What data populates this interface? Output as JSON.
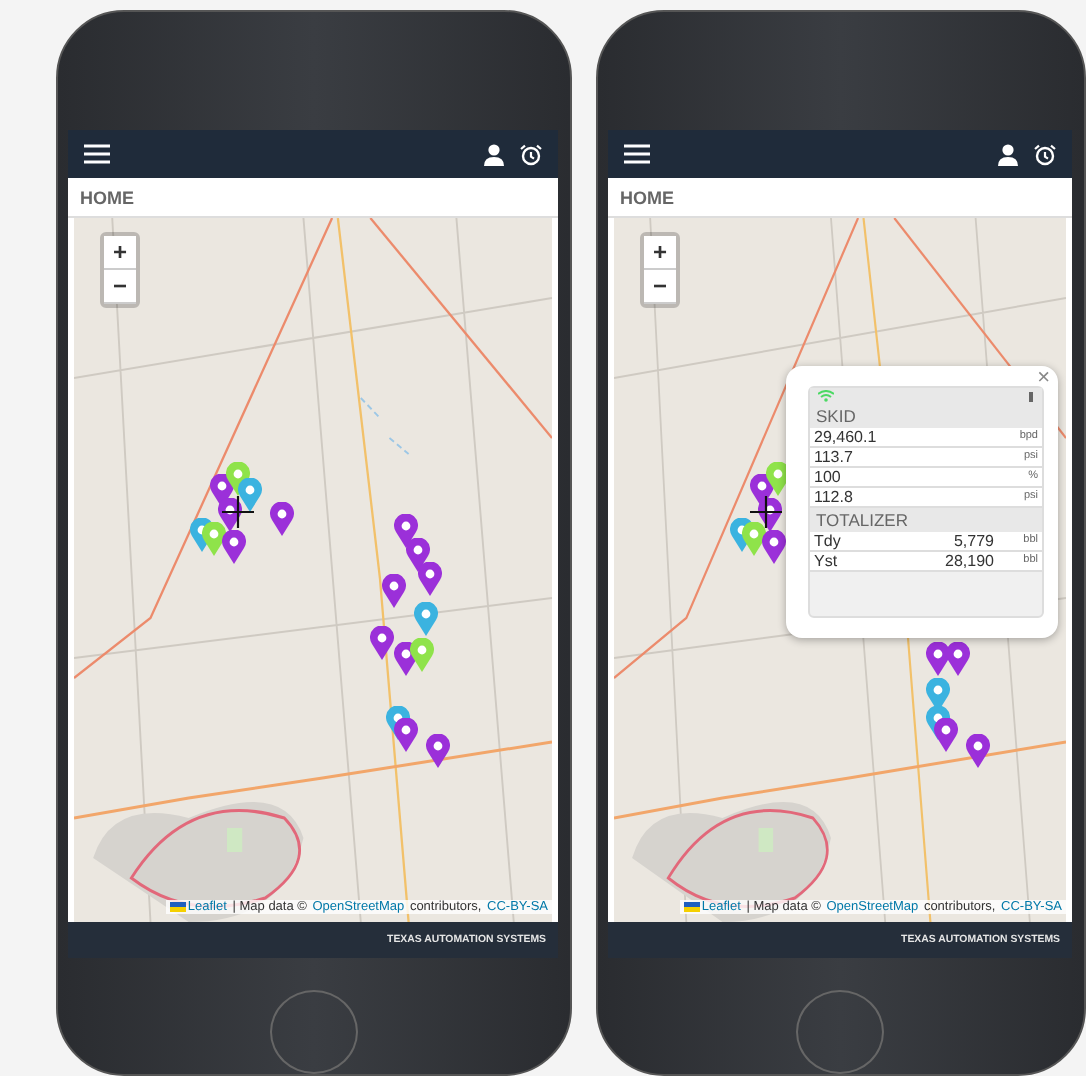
{
  "phones": [
    {
      "header": "HOME",
      "zoom": [
        "+",
        "−"
      ],
      "attribution": [
        {
          "text": "Leaflet",
          "link": true
        },
        {
          "text": " | Map data © ",
          "link": false
        },
        {
          "text": "OpenStreetMap",
          "link": true
        },
        {
          "text": " contributors, ",
          "link": false
        },
        {
          "text": "CC-BY-SA",
          "link": true
        }
      ],
      "footer": "TEXAS AUTOMATION SYSTEMS"
    },
    {
      "header": "HOME",
      "zoom": [
        "+",
        "−"
      ],
      "attribution": [
        {
          "text": "Leaflet",
          "link": true
        },
        {
          "text": " | Map data © ",
          "link": false
        },
        {
          "text": "OpenStreetMap",
          "link": true
        },
        {
          "text": " contributors, ",
          "link": false
        },
        {
          "text": "CC-BY-SA",
          "link": true
        }
      ],
      "footer": "TEXAS AUTOMATION SYSTEMS",
      "popup": {
        "close": "×",
        "sections": [
          {
            "title": "SKID",
            "rows": [
              {
                "value": "29,460.1",
                "unit": "bpd"
              },
              {
                "value": "113.7",
                "unit": "psi"
              },
              {
                "value": "100",
                "unit": "%"
              },
              {
                "value": "112.8",
                "unit": "psi"
              }
            ]
          },
          {
            "title": "TOTALIZER",
            "rows": [
              {
                "label": "Tdy",
                "value": "5,779",
                "unit": "bbl"
              },
              {
                "label": "Yst",
                "value": "28,190",
                "unit": "bbl"
              }
            ]
          }
        ]
      }
    }
  ]
}
